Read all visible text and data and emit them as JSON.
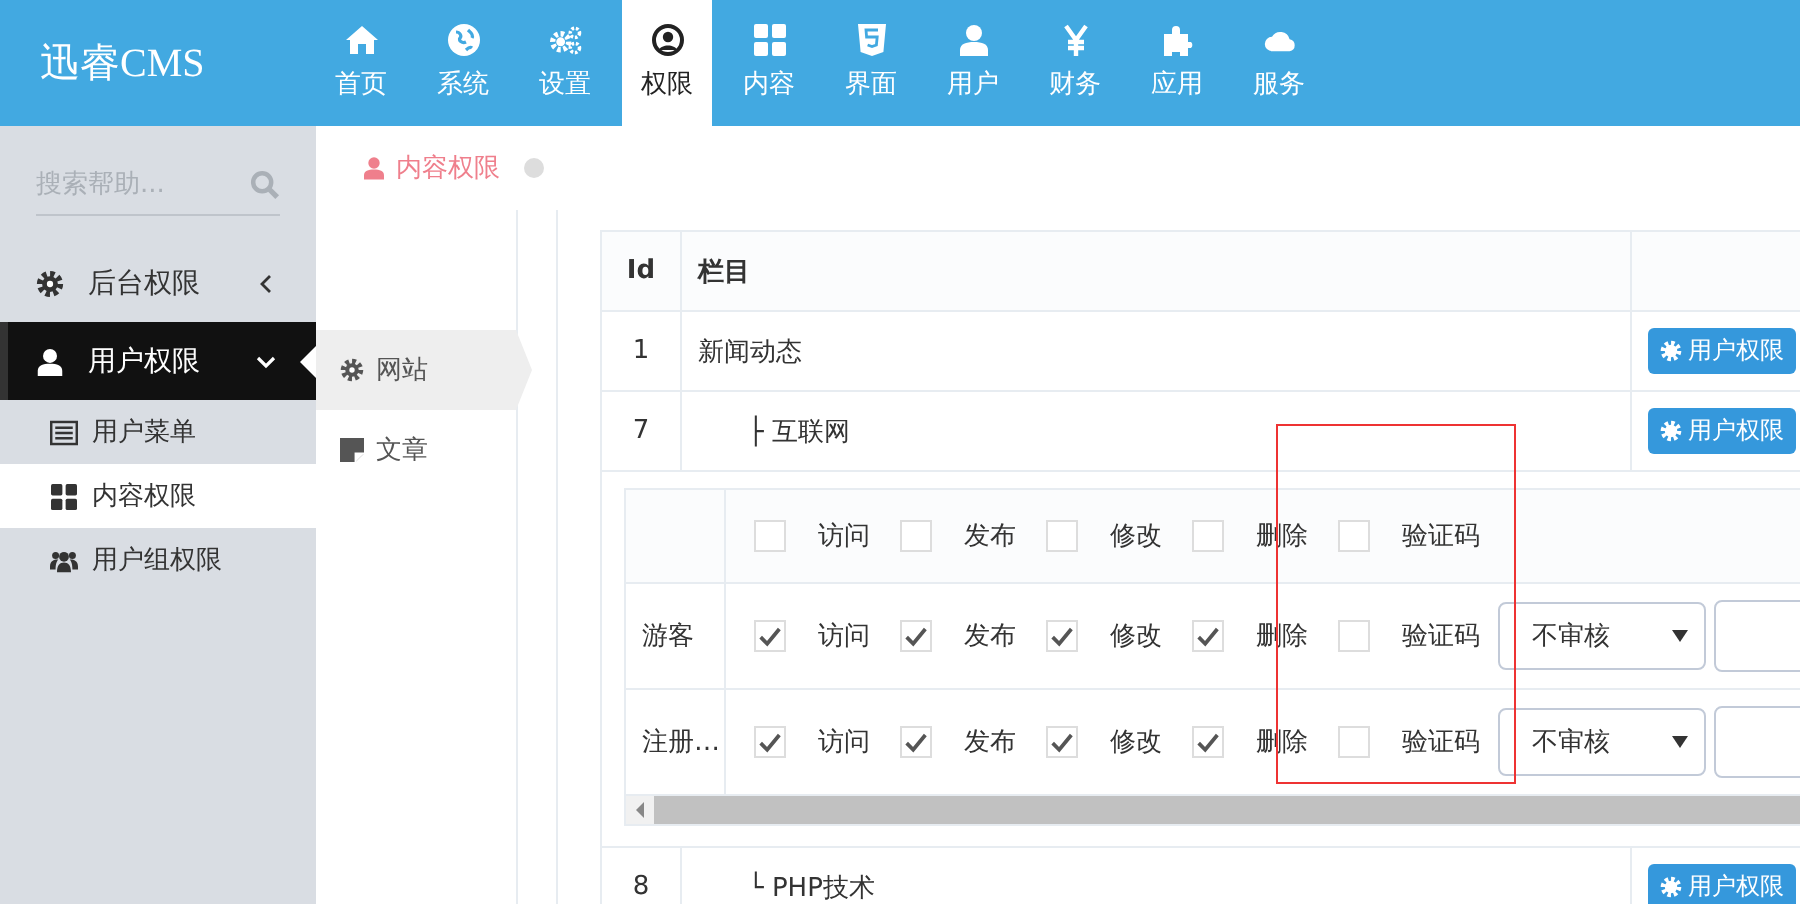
{
  "brand": {
    "name": "迅睿CMS"
  },
  "nav": [
    {
      "label": "首页",
      "selected": false
    },
    {
      "label": "系统",
      "selected": false
    },
    {
      "label": "设置",
      "selected": false
    },
    {
      "label": "权限",
      "selected": true
    },
    {
      "label": "内容",
      "selected": false
    },
    {
      "label": "界面",
      "selected": false
    },
    {
      "label": "用户",
      "selected": false
    },
    {
      "label": "财务",
      "selected": false
    },
    {
      "label": "应用",
      "selected": false
    },
    {
      "label": "服务",
      "selected": false
    }
  ],
  "sidebar": {
    "search": {
      "placeholder": "搜索帮助..."
    },
    "menus": [
      {
        "label": "后台权限",
        "expanded": false
      },
      {
        "label": "用户权限",
        "expanded": true,
        "children": [
          {
            "label": "用户菜单",
            "selected": false
          },
          {
            "label": "内容权限",
            "selected": true
          },
          {
            "label": "用户组权限",
            "selected": false
          }
        ]
      }
    ]
  },
  "breadcrumb": {
    "label": "内容权限"
  },
  "submenu": [
    {
      "label": "网站",
      "selected": true
    },
    {
      "label": "文章",
      "selected": false
    }
  ],
  "table": {
    "columns": [
      "Id",
      "栏目"
    ],
    "rows": [
      {
        "id": "1",
        "name": "新闻动态",
        "button": "用户权限",
        "children": [
          {
            "id": "7",
            "prefix": "├",
            "name": "互联网",
            "button": "用户权限",
            "permissions": {
              "header": [
                {
                  "label": "访问",
                  "checked": false
                },
                {
                  "label": "发布",
                  "checked": false
                },
                {
                  "label": "修改",
                  "checked": false
                },
                {
                  "label": "删除",
                  "checked": false
                },
                {
                  "label": "验证码",
                  "checked": false
                }
              ],
              "groups": [
                {
                  "name": "游客",
                  "perms": [
                    {
                      "label": "访问",
                      "checked": true
                    },
                    {
                      "label": "发布",
                      "checked": true
                    },
                    {
                      "label": "修改",
                      "checked": true
                    },
                    {
                      "label": "删除",
                      "checked": true
                    },
                    {
                      "label": "验证码",
                      "checked": false
                    }
                  ],
                  "review": "不审核"
                },
                {
                  "name": "注册…",
                  "perms": [
                    {
                      "label": "访问",
                      "checked": true
                    },
                    {
                      "label": "发布",
                      "checked": true
                    },
                    {
                      "label": "修改",
                      "checked": true
                    },
                    {
                      "label": "删除",
                      "checked": true
                    },
                    {
                      "label": "验证码",
                      "checked": false
                    }
                  ],
                  "review": "不审核"
                }
              ]
            }
          },
          {
            "id": "8",
            "prefix": "└",
            "name": "PHP技术",
            "button": "用户权限"
          }
        ]
      }
    ]
  }
}
